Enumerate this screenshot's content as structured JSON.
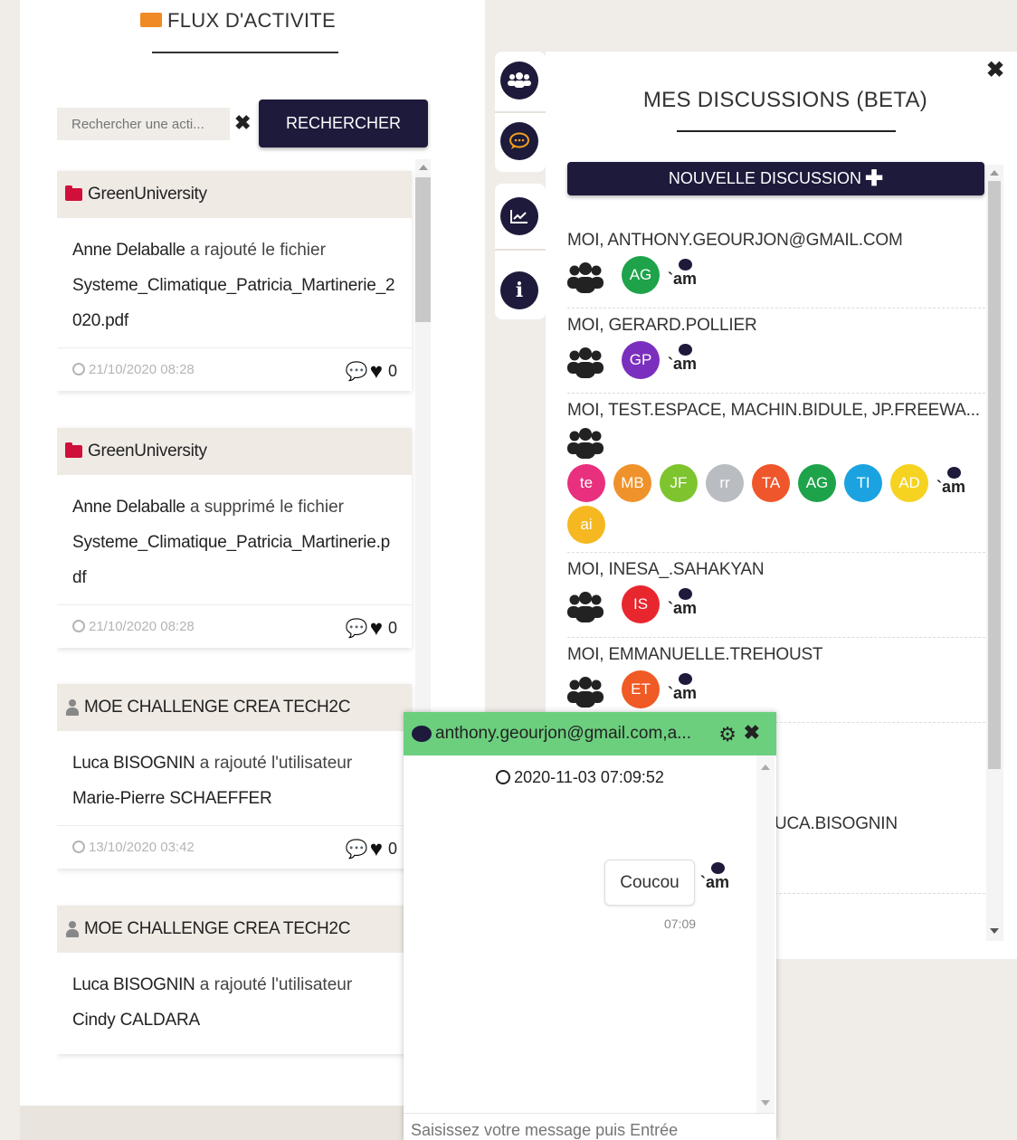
{
  "activity": {
    "title": "FLUX D'ACTIVITE",
    "search_placeholder": "Rechercher une acti...",
    "search_button": "RECHERCHER",
    "clear_icon": "✖",
    "items": [
      {
        "space": "GreenUniversity",
        "space_type": "folder",
        "actor": "Anne Delaballe",
        "action": "a rajouté le fichier",
        "object": "Systeme_Climatique_Patricia_Martinerie_2020.pdf",
        "date": "21/10/2020 08:28",
        "likes": "0"
      },
      {
        "space": "GreenUniversity",
        "space_type": "folder",
        "actor": "Anne Delaballe",
        "action": "a supprimé le fichier",
        "object": "Systeme_Climatique_Patricia_Martinerie.pdf",
        "date": "21/10/2020 08:28",
        "likes": "0"
      },
      {
        "space": "MOE CHALLENGE CREA TECH2C",
        "space_type": "user",
        "actor": "Luca BISOGNIN",
        "action": "a rajouté l'utilisateur",
        "object": "Marie-Pierre SCHAEFFER",
        "date": "13/10/2020 03:42",
        "likes": "0"
      },
      {
        "space": "MOE CHALLENGE CREA TECH2C",
        "space_type": "user",
        "actor": "Luca BISOGNIN",
        "action": "a rajouté l'utilisateur",
        "object": "Cindy CALDARA",
        "date": "",
        "likes": ""
      }
    ]
  },
  "rail": {
    "icons": [
      "group-icon",
      "chat-icon",
      "chart-line-icon",
      "info-icon"
    ]
  },
  "discussions": {
    "title": "MES DISCUSSIONS (BETA)",
    "new_button": "NOUVELLE DISCUSSION",
    "close": "✖",
    "bot_text": "`am",
    "items": [
      {
        "name": "MOI, ANTHONY.GEOURJON@GMAIL.COM",
        "avatars": [
          {
            "initials": "AG",
            "color": "#1ea34a"
          }
        ]
      },
      {
        "name": "MOI, GERARD.POLLIER",
        "avatars": [
          {
            "initials": "GP",
            "color": "#7b2fbe"
          }
        ]
      },
      {
        "name": "MOI, TEST.ESPACE, MACHIN.BIDULE, JP.FREEWA...",
        "avatars": [
          {
            "initials": "te",
            "color": "#e8307f"
          },
          {
            "initials": "MB",
            "color": "#f0922b"
          },
          {
            "initials": "JF",
            "color": "#7ec42f"
          },
          {
            "initials": "rr",
            "color": "#b9bcc0"
          },
          {
            "initials": "TA",
            "color": "#f0562b"
          },
          {
            "initials": "AG",
            "color": "#1ea34a"
          },
          {
            "initials": "TI",
            "color": "#1aa3e0"
          },
          {
            "initials": "AD",
            "color": "#f5d320"
          },
          {
            "initials": "ai",
            "color": "#f5b820"
          }
        ]
      },
      {
        "name": "MOI, INESA_.SAHAKYAN",
        "avatars": [
          {
            "initials": "IS",
            "color": "#e8262e"
          }
        ]
      },
      {
        "name": "MOI, EMMANUELLE.TREHOUST",
        "avatars": [
          {
            "initials": "ET",
            "color": "#f05a24"
          }
        ]
      },
      {
        "name": "UCA.BISOGNIN",
        "avatars": []
      }
    ]
  },
  "chat": {
    "title": "anthony.geourjon@gmail.com,a...",
    "date": "2020-11-03 07:09:52",
    "message": "Coucou",
    "message_time": "07:09",
    "bot_text": "`am",
    "input_placeholder": "Saisissez votre message puis Entrée"
  }
}
